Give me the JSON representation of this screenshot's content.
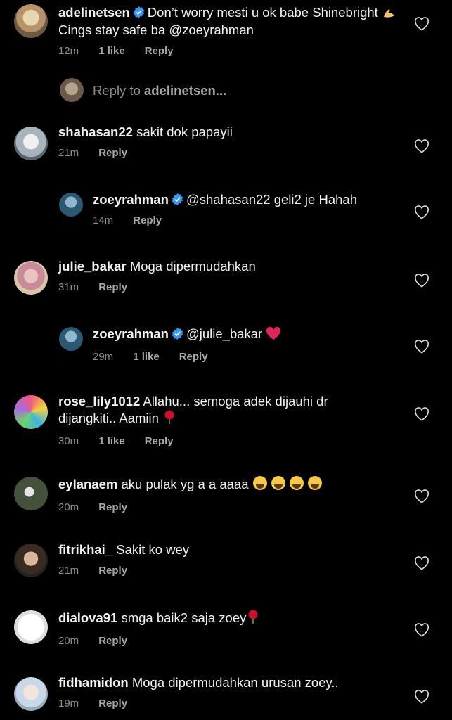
{
  "reply_prompt": {
    "prefix": "Reply to ",
    "user": "adelinetsen..."
  },
  "comments": [
    {
      "user": "adelinetsen",
      "verified": true,
      "text": "Don’t worry mesti u ok babe Shinebright",
      "text2": "Cings stay safe ba @zoeyrahman",
      "time": "12m",
      "likes": "1 like",
      "reply": "Reply"
    },
    {
      "user": "shahasan22",
      "text": "sakit dok papayii",
      "time": "21m",
      "reply": "Reply"
    },
    {
      "user": "zoeyrahman",
      "verified": true,
      "text": "@shahasan22 geli2 je Hahah",
      "time": "14m",
      "reply": "Reply"
    },
    {
      "user": "julie_bakar",
      "text": "Moga dipermudahkan",
      "time": "31m",
      "reply": "Reply"
    },
    {
      "user": "zoeyrahman",
      "verified": true,
      "text": "@julie_bakar",
      "time": "29m",
      "likes": "1 like",
      "reply": "Reply"
    },
    {
      "user": "rose_lily1012",
      "text": "Allahu... semoga adek dijauhi dr",
      "text2": "dijangkiti.. Aamiin",
      "time": "30m",
      "likes": "1 like",
      "reply": "Reply"
    },
    {
      "user": "eylanaem",
      "text": "aku pulak yg a a aaaa",
      "time": "20m",
      "reply": "Reply"
    },
    {
      "user": "fitrikhai_",
      "text": "Sakit ko wey",
      "time": "21m",
      "reply": "Reply"
    },
    {
      "user": "dialova91",
      "text": "smga baik2 saja zoey",
      "time": "20m",
      "reply": "Reply"
    },
    {
      "user": "fidhamidon",
      "text": "Moga dipermudahkan urusan zoey..",
      "time": "19m",
      "reply": "Reply"
    }
  ]
}
